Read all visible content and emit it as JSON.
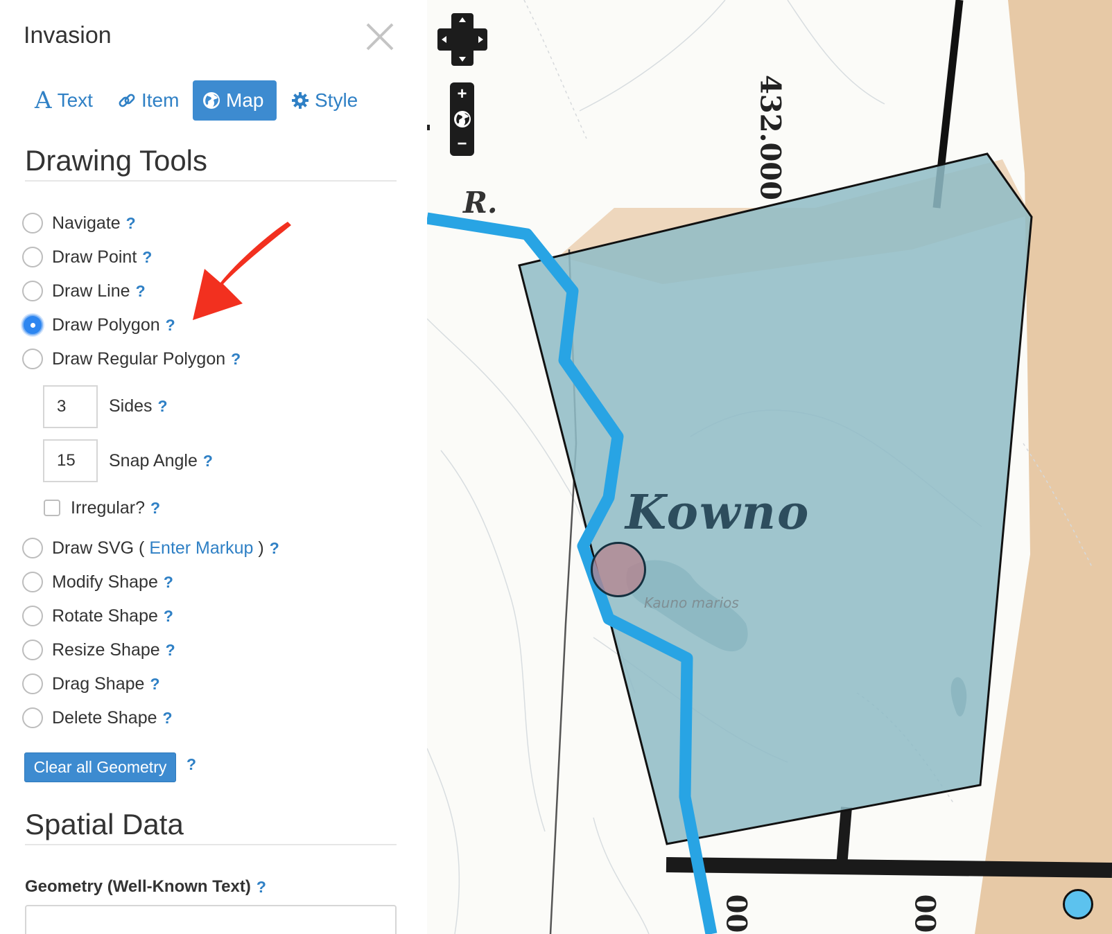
{
  "panel": {
    "title": "Invasion",
    "close_icon": "close-icon"
  },
  "tabs": [
    {
      "label": "Text",
      "icon": "serif-a-icon",
      "active": false
    },
    {
      "label": "Item",
      "icon": "link-icon",
      "active": false
    },
    {
      "label": "Map",
      "icon": "globe-icon",
      "active": true
    },
    {
      "label": "Style",
      "icon": "gear-icon",
      "active": false
    }
  ],
  "drawing_tools": {
    "heading": "Drawing Tools",
    "help_glyph": "?",
    "tools": [
      {
        "label": "Navigate",
        "checked": false
      },
      {
        "label": "Draw Point",
        "checked": false
      },
      {
        "label": "Draw Line",
        "checked": false
      },
      {
        "label": "Draw Polygon",
        "checked": true
      },
      {
        "label": "Draw Regular Polygon",
        "checked": false
      }
    ],
    "sides": {
      "value": "3",
      "label": "Sides"
    },
    "snap_angle": {
      "value": "15",
      "label": "Snap Angle"
    },
    "irregular": {
      "label": "Irregular?",
      "checked": false
    },
    "svg_tool": {
      "label_before": "Draw SVG (",
      "link": "Enter Markup",
      "label_after": ")"
    },
    "shape_tools": [
      {
        "label": "Modify Shape",
        "checked": false
      },
      {
        "label": "Rotate Shape",
        "checked": false
      },
      {
        "label": "Resize Shape",
        "checked": false
      },
      {
        "label": "Drag Shape",
        "checked": false
      },
      {
        "label": "Delete Shape",
        "checked": false
      }
    ],
    "clear_button": "Clear all Geometry"
  },
  "spatial_data": {
    "heading": "Spatial Data",
    "geometry_label": "Geometry (Well-Known Text)"
  },
  "map": {
    "labels": {
      "town": "Kowno",
      "small": "Kauno marios",
      "river_abbrev": "R.",
      "latitude": "432.000",
      "bottom_left": "00",
      "bottom_right": "00"
    },
    "controls": {
      "pan_icon": "pan-arrows-icon",
      "zoom_in": "+",
      "zoom_out": "−",
      "globe_icon": "globe-icon"
    },
    "colors": {
      "polygon_fill": "#8fbcc6",
      "polygon_stroke": "#111111",
      "river": "#28a4e4",
      "region": "#e7c9a6",
      "vertex": "#b5818c"
    }
  }
}
